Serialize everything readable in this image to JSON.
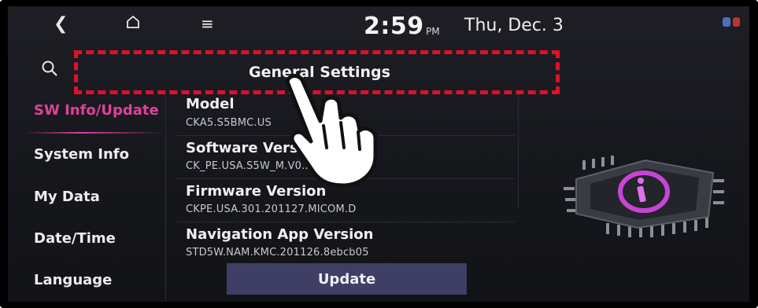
{
  "topbar": {
    "time": "2:59",
    "ampm": "PM",
    "date": "Thu, Dec. 3"
  },
  "header": {
    "title": "General Settings"
  },
  "sidebar": {
    "items": [
      {
        "label": "SW Info/Update",
        "active": true
      },
      {
        "label": "System Info",
        "active": false
      },
      {
        "label": "My Data",
        "active": false
      },
      {
        "label": "Date/Time",
        "active": false
      },
      {
        "label": "Language",
        "active": false
      }
    ]
  },
  "info": {
    "rows": [
      {
        "label": "Model",
        "value": "CKA5.S5BMC.US"
      },
      {
        "label": "Software Version",
        "value": "CK_PE.USA.S5W_M.V0...01.201130"
      },
      {
        "label": "Firmware Version",
        "value": "CKPE.USA.301.201127.MICOM.D"
      },
      {
        "label": "Navigation App Version",
        "value": "STD5W.NAM.KMC.201126.8ebcb05"
      }
    ]
  },
  "buttons": {
    "update": "Update"
  },
  "colors": {
    "accent": "#e0409a",
    "highlight": "#e0102a",
    "button": "#3f3e64"
  },
  "icons": [
    "back-icon",
    "home-icon",
    "menu-icon",
    "search-icon",
    "chip-info-icon",
    "pointing-hand-icon"
  ]
}
